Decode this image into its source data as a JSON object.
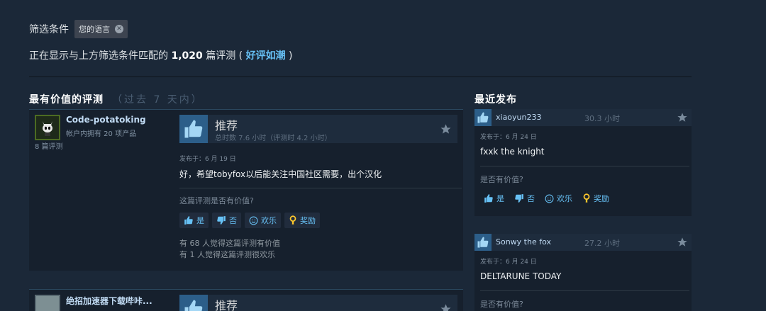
{
  "filter": {
    "label": "筛选条件",
    "chip": "您的语言"
  },
  "summary": {
    "prefix": "正在显示与上方筛选条件匹配的",
    "count": "1,020",
    "unit": "篇评测 (",
    "rating": "好评如潮",
    "suffix": ")"
  },
  "sections": {
    "most_helpful": "最有价值的评测",
    "most_helpful_sub": "（过去 7 天内）",
    "recent": "最近发布"
  },
  "vote_labels": {
    "question": "这篇评测是否有价值?",
    "yes": "是",
    "no": "否",
    "funny": "欢乐",
    "award": "奖励",
    "side_question": "是否有价值?"
  },
  "reviews": [
    {
      "author": "Code-potatoking",
      "owned": "帐户内拥有 20 项产品",
      "review_count": "8 篇评测",
      "verdict": "推荐",
      "hours": "总时数 7.6 小时（评测时 4.2 小时）",
      "posted": "发布于：6 月 19 日",
      "content": "好，希望tobyfox以后能关注中国社区需要，出个汉化",
      "helpful_line": "有 68 人觉得这篇评测有价值",
      "funny_line": "有 1 人觉得这篇评测很欢乐"
    },
    {
      "author": "绝招加速器下载哔咔...",
      "verdict": "推荐"
    }
  ],
  "recent": [
    {
      "author": "xiaoyun233",
      "hours": "30.3 小时",
      "posted": "发布于：6 月 24 日",
      "content": "fxxk the knight"
    },
    {
      "author": "Sonwy the fox",
      "hours": "27.2 小时",
      "posted": "发布于：6 月 24 日",
      "content": "DELTARUNE TODAY"
    }
  ],
  "colors": {
    "background": "#1b2838",
    "link": "#66c0f4",
    "thumb_box": "#2c5e89"
  },
  "icons": {
    "thumbs_up": "thumbs-up-icon",
    "thumbs_down": "thumbs-down-icon",
    "star": "star-icon",
    "smiley": "smiley-icon",
    "award": "award-icon",
    "close": "close-icon"
  }
}
